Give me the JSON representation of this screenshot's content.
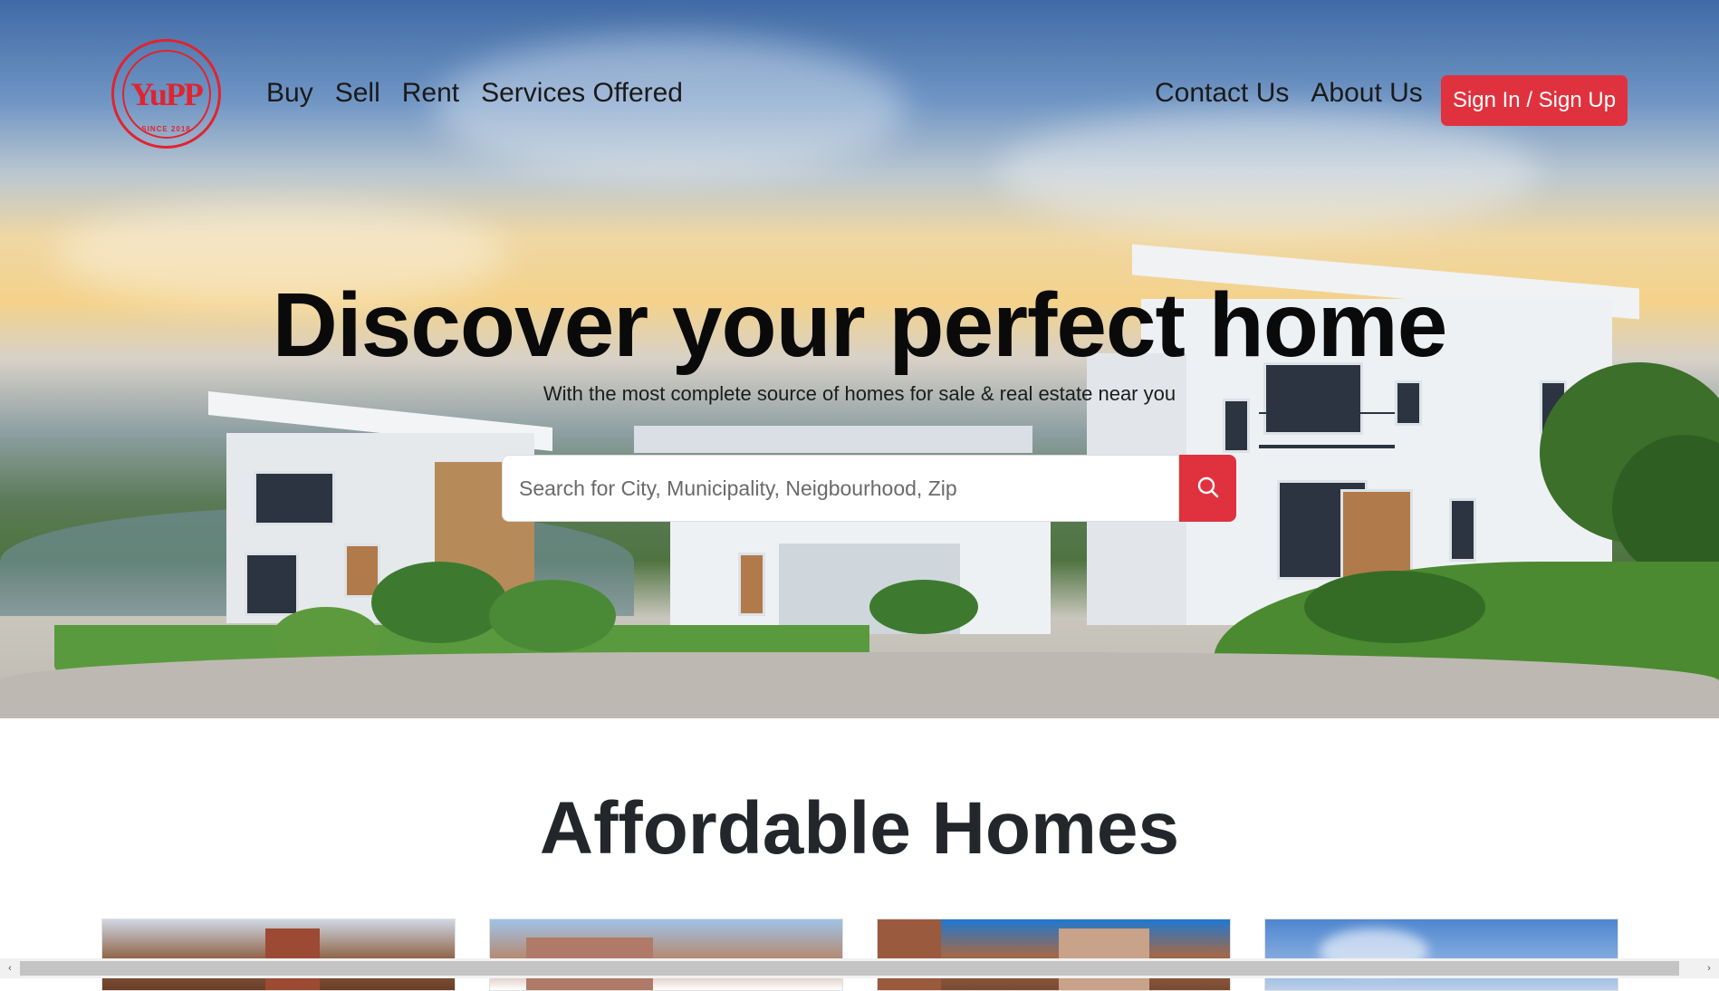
{
  "brand": {
    "logo_letters": "YuPP",
    "logo_tagline": "SINCE 2018",
    "accent_color": "#e0323e"
  },
  "nav": {
    "left_links": [
      {
        "label": "Buy"
      },
      {
        "label": "Sell"
      },
      {
        "label": "Rent"
      },
      {
        "label": "Services Offered"
      }
    ],
    "right_links": [
      {
        "label": "Contact Us"
      },
      {
        "label": "About Us"
      }
    ],
    "signin_label": "Sign In / Sign Up"
  },
  "hero": {
    "title": "Discover your perfect home",
    "subtitle": "With the most complete source of homes for sale & real estate near you",
    "search_placeholder": "Search for City, Municipality, Neigbourhood, Zip",
    "search_icon": "search-icon"
  },
  "section": {
    "title": "Affordable Homes"
  }
}
